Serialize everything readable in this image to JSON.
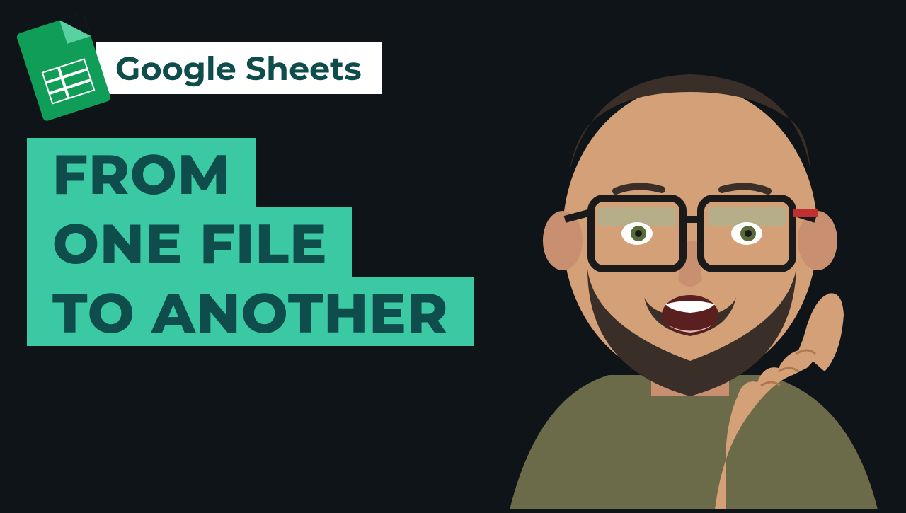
{
  "header": {
    "label": "Google Sheets"
  },
  "title": {
    "line1": "FROM",
    "line2": "ONE FILE",
    "line3": "TO ANOTHER"
  },
  "colors": {
    "background": "#0f1419",
    "accent": "#3bc9a3",
    "iconGreen": "#0f9d58",
    "textDark": "#0f4c4c",
    "labelBg": "#ffffff"
  },
  "icon": {
    "name": "google-sheets-icon"
  }
}
